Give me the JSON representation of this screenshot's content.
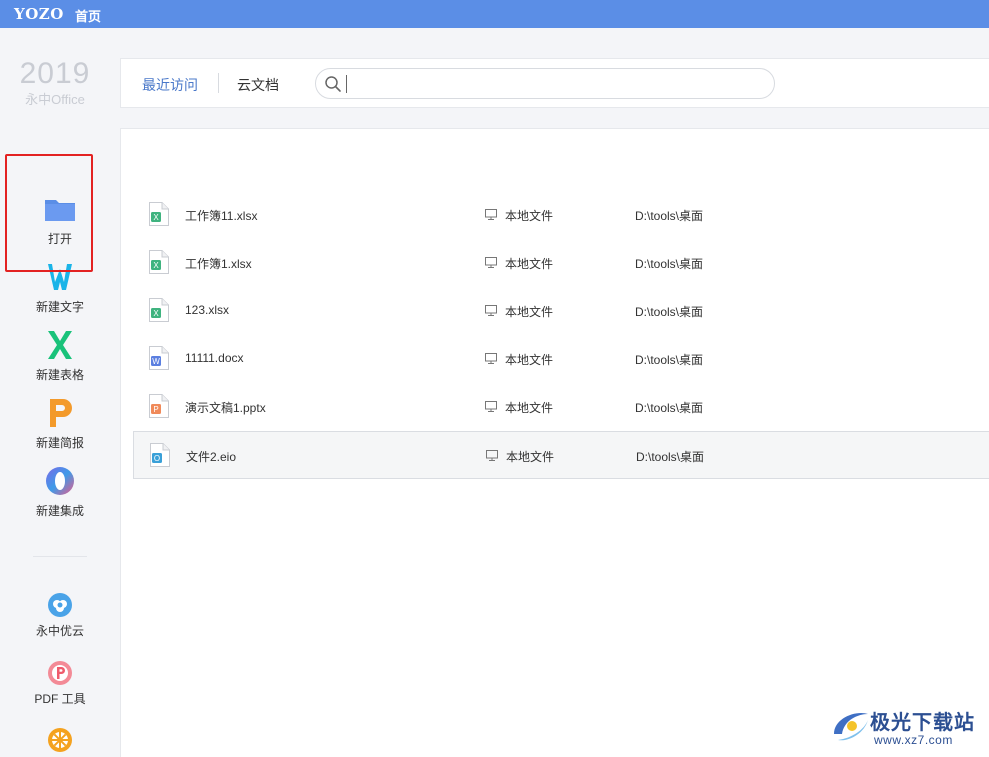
{
  "topbar": {
    "brand": "YOZO",
    "title": "首页",
    "color": "#5b8ee6"
  },
  "sidebar": {
    "year": "2019",
    "subbrand": "永中Office",
    "items": [
      {
        "label": "打开",
        "icon": "folder-icon",
        "color": "#5b8ee6"
      },
      {
        "label": "新建文字",
        "icon": "word-w-icon",
        "color": "#1ab4e8"
      },
      {
        "label": "新建表格",
        "icon": "sheet-x-icon",
        "color": "#19c27a"
      },
      {
        "label": "新建简报",
        "icon": "presentation-p-icon",
        "color": "#f39a2b"
      },
      {
        "label": "新建集成",
        "icon": "integration-o-icon",
        "color": "#8a6ce0"
      }
    ],
    "tools": [
      {
        "label": "永中优云",
        "icon": "cloud-icon",
        "color": "#4aa3e8"
      },
      {
        "label": "PDF 工具",
        "icon": "pdf-icon",
        "color": "#ef6b78"
      },
      {
        "label": "",
        "icon": "orange-tool-icon",
        "color": "#f4a21f"
      }
    ]
  },
  "header": {
    "tab_recent": "最近访问",
    "tab_cloud": "云文档",
    "search_placeholder": ""
  },
  "files": [
    {
      "name": "工作簿11.xlsx",
      "type": "xlsx",
      "location": "本地文件",
      "path": "D:\\tools\\桌面"
    },
    {
      "name": "工作簿1.xlsx",
      "type": "xlsx",
      "location": "本地文件",
      "path": "D:\\tools\\桌面"
    },
    {
      "name": "123.xlsx",
      "type": "xlsx",
      "location": "本地文件",
      "path": "D:\\tools\\桌面"
    },
    {
      "name": "11111.docx",
      "type": "docx",
      "location": "本地文件",
      "path": "D:\\tools\\桌面"
    },
    {
      "name": "演示文稿1.pptx",
      "type": "pptx",
      "location": "本地文件",
      "path": "D:\\tools\\桌面"
    },
    {
      "name": "文件2.eio",
      "type": "eio",
      "location": "本地文件",
      "path": "D:\\tools\\桌面",
      "selected": true
    }
  ],
  "file_type_colors": {
    "xlsx": "#3fb37f",
    "docx": "#5b7fe0",
    "pptx": "#f08a5a",
    "eio": "#3aa0d8"
  },
  "file_type_letters": {
    "xlsx": "X",
    "docx": "W",
    "pptx": "P",
    "eio": "O"
  },
  "highlight_color": "#e32222",
  "watermark": {
    "text": "极光下载站",
    "url": "www.xz7.com"
  }
}
